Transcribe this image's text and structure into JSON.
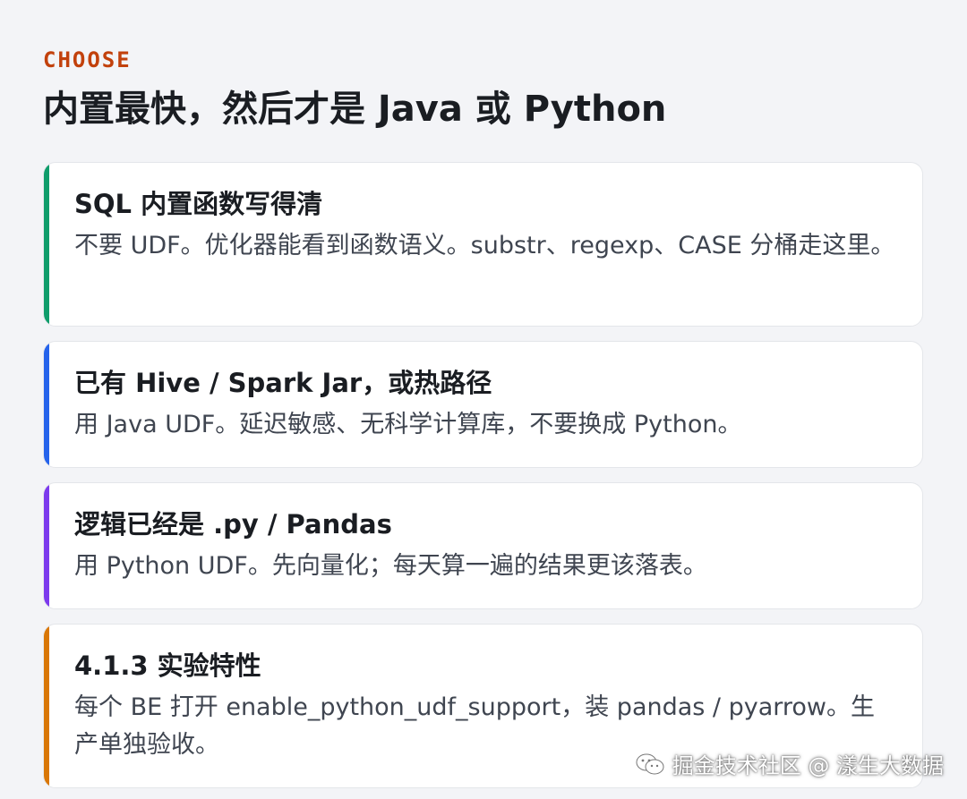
{
  "eyebrow": "CHOOSE",
  "headline": "内置最快，然后才是 Java 或 Python",
  "cards": [
    {
      "title": "SQL 内置函数写得清",
      "body": "不要 UDF。优化器能看到函数语义。substr、regexp、CASE 分桶走这里。",
      "accent": "#0f9d6b"
    },
    {
      "title": "已有 Hive / Spark Jar，或热路径",
      "body": "用 Java UDF。延迟敏感、无科学计算库，不要换成 Python。",
      "accent": "#2563eb"
    },
    {
      "title": "逻辑已经是 .py / Pandas",
      "body": "用 Python UDF。先向量化；每天算一遍的结果更该落表。",
      "accent": "#7c3aed"
    },
    {
      "title": "4.1.3 实验特性",
      "body": "每个 BE 打开 enable_python_udf_support，装 pandas / pyarrow。生产单独验收。",
      "accent": "#d97706"
    }
  ],
  "watermark": {
    "text": "掘金技术社区 @ 漾生大数据",
    "icon": "wechat-icon"
  }
}
